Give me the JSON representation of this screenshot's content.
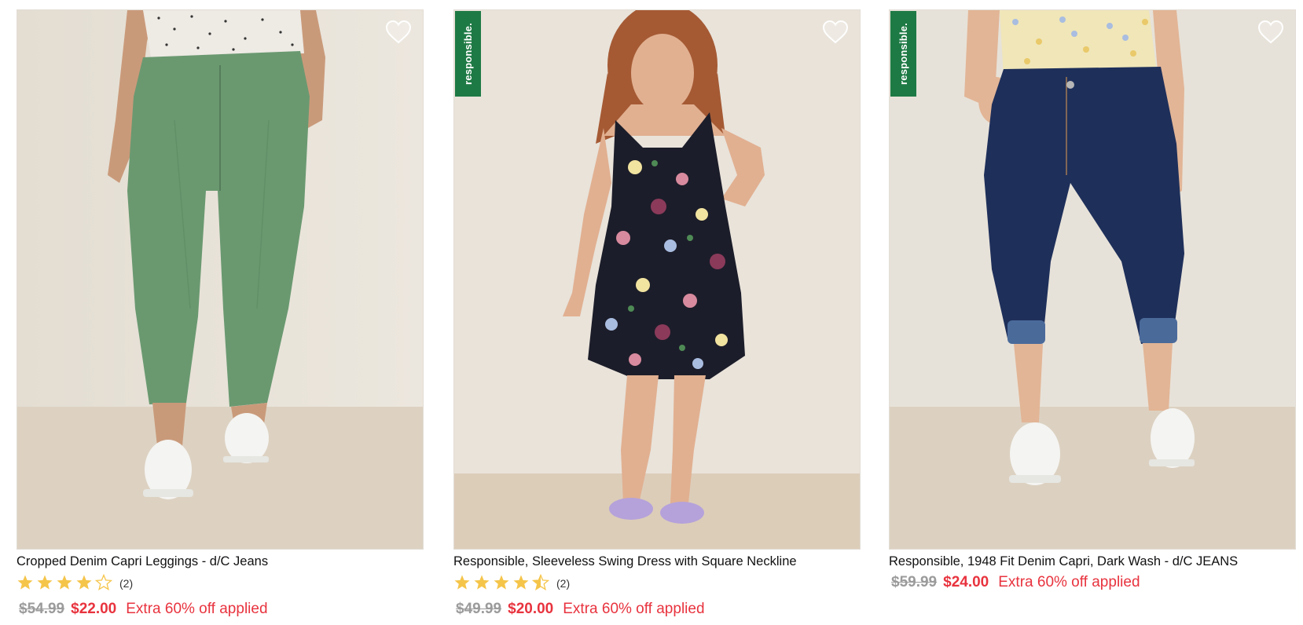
{
  "colors": {
    "sale_red": "#e8333e",
    "strike_gray": "#9b9b9b",
    "star_gold": "#f5c54a",
    "responsible_green": "#1e7a45"
  },
  "products": [
    {
      "name": "Cropped Denim Capri Leggings - d/C Jeans",
      "badge": "",
      "wishlist_icon": "heart-outline-icon",
      "rating": 4,
      "rating_count": "(2)",
      "was_price": "$54.99",
      "sale_price": "$22.00",
      "promo": "Extra 60% off applied",
      "image": "woman in sage green cropped capri jeans and white sneakers"
    },
    {
      "name": "Responsible, Sleeveless Swing Dress with Square Neckline",
      "badge": "responsible.",
      "wishlist_icon": "heart-outline-icon",
      "rating": 4.5,
      "rating_count": "(2)",
      "was_price": "$49.99",
      "sale_price": "$20.00",
      "promo": "Extra 60% off applied",
      "image": "woman in black floral sleeveless swing dress with lilac slides"
    },
    {
      "name": "Responsible, 1948 Fit Denim Capri, Dark Wash - d/C JEANS",
      "badge": "responsible.",
      "wishlist_icon": "heart-outline-icon",
      "rating": null,
      "rating_count": "",
      "was_price": "$59.99",
      "sale_price": "$24.00",
      "promo": "Extra 60% off applied",
      "image": "woman in dark wash cuffed denim capris and white sneakers"
    }
  ]
}
